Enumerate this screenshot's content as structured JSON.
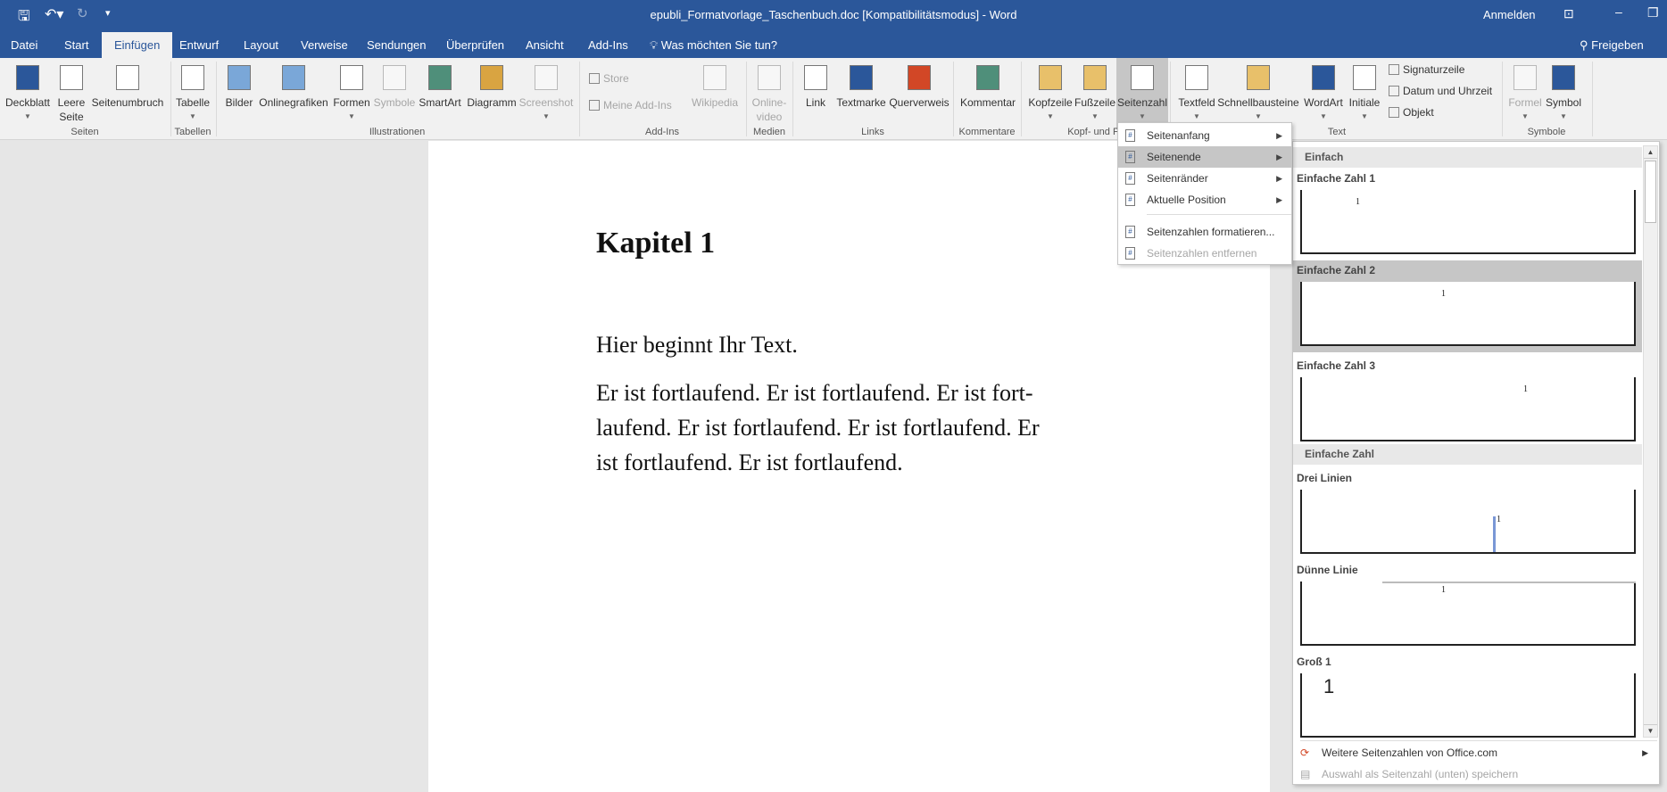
{
  "titlebar": {
    "title": "epubli_Formatvorlage_Taschenbuch.doc [Kompatibilitätsmodus]  -  Word",
    "signin": "Anmelden",
    "share": "Freigeben"
  },
  "tabs": [
    "Datei",
    "Start",
    "Einfügen",
    "Entwurf",
    "Layout",
    "Verweise",
    "Sendungen",
    "Überprüfen",
    "Ansicht",
    "Add-Ins"
  ],
  "tell_me": "Was möchten Sie tun?",
  "ribbon": {
    "buttons": [
      {
        "l1": "Deckblatt",
        "l2": "",
        "arrow": true
      },
      {
        "l1": "Leere",
        "l2": "Seite"
      },
      {
        "l1": "Seitenumbruch",
        "l2": ""
      },
      {
        "l1": "Tabelle",
        "arrow": true
      },
      {
        "l1": "Bilder"
      },
      {
        "l1": "Onlinegrafiken"
      },
      {
        "l1": "Formen",
        "arrow": true
      },
      {
        "l1": "Symbole"
      },
      {
        "l1": "SmartArt"
      },
      {
        "l1": "Diagramm"
      },
      {
        "l1": "Screenshot",
        "arrow": true
      },
      {
        "l1": "Wikipedia"
      },
      {
        "l1": "Online-",
        "l2": "video"
      },
      {
        "l1": "Link"
      },
      {
        "l1": "Textmarke"
      },
      {
        "l1": "Querverweis"
      },
      {
        "l1": "Kommentar"
      },
      {
        "l1": "Kopfzeile",
        "arrow": true
      },
      {
        "l1": "Fußzeile",
        "arrow": true
      },
      {
        "l1": "Seitenzahl",
        "arrow": true
      },
      {
        "l1": "Textfeld",
        "arrow": true
      },
      {
        "l1": "Schnellbausteine",
        "arrow": true
      },
      {
        "l1": "WordArt",
        "arrow": true
      },
      {
        "l1": "Initiale",
        "arrow": true
      },
      {
        "l1": "Formel",
        "arrow": true
      },
      {
        "l1": "Symbol",
        "arrow": true
      }
    ],
    "small": {
      "store": "Store",
      "my_addins": "Meine Add-Ins",
      "signature": "Signaturzeile",
      "datetime": "Datum und Uhrzeit",
      "object": "Objekt"
    },
    "groups": [
      "Seiten",
      "Tabellen",
      "Illustrationen",
      "Add-Ins",
      "Medien",
      "Links",
      "Kommentare",
      "Kopf- und Fu",
      "Text",
      "Symbole"
    ]
  },
  "document": {
    "heading": "Kapitel 1",
    "lines": [
      "Hier beginnt Ihr Text.",
      "Er ist fortlaufend. Er ist fortlaufend. Er ist fort-",
      "laufend. Er ist fortlaufend. Er ist fortlaufend. Er",
      "ist fortlaufend. Er ist fortlaufend."
    ]
  },
  "menu": [
    {
      "label": "Seitenanfang",
      "submenu": true
    },
    {
      "label": "Seitenende",
      "submenu": true,
      "highlighted": true
    },
    {
      "label": "Seitenränder",
      "submenu": true
    },
    {
      "label": "Aktuelle Position",
      "submenu": true
    },
    {
      "label": "Seitenzahlen formatieren..."
    },
    {
      "label": "Seitenzahlen entfernen",
      "disabled": true
    }
  ],
  "gallery": {
    "sections": [
      "Einfach",
      "Einfache Zahl"
    ],
    "items": [
      {
        "label": "Einfache Zahl 1",
        "num": "1"
      },
      {
        "label": "Einfache Zahl 2",
        "num": "1",
        "highlighted": true
      },
      {
        "label": "Einfache Zahl 3",
        "num": "1"
      },
      {
        "label": "Drei Linien",
        "num": "1"
      },
      {
        "label": "Dünne Linie",
        "num": "1"
      },
      {
        "label": "Groß 1",
        "num": "1"
      }
    ],
    "more": "Weitere Seitenzahlen von Office.com",
    "save": "Auswahl als Seitenzahl (unten) speichern"
  },
  "colors": {
    "accent": "#2b579a",
    "ribbon": "#f1f1f1",
    "highlight": "#c6c6c6"
  }
}
